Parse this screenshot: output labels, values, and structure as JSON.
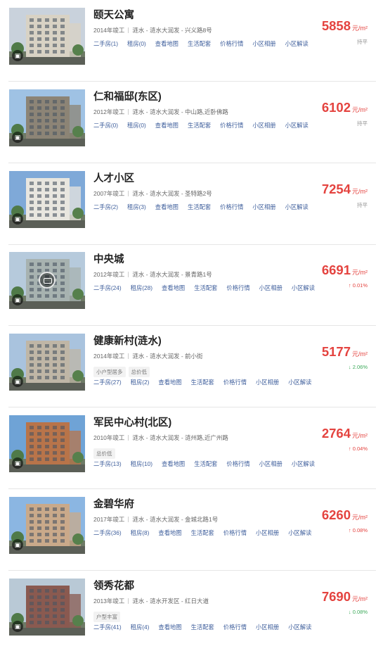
{
  "listings": [
    {
      "name": "颐天公寓",
      "year": "2014年竣工",
      "location": "涟水 - 涟水大润发 - 兴义路8号",
      "tags": [],
      "links": [
        "二手房(1)",
        "租房(0)",
        "查看地图",
        "生活配套",
        "价格行情",
        "小区相册",
        "小区解读"
      ],
      "price": "5858",
      "unit": "元/m²",
      "change": "持平",
      "trend": "flat",
      "sky": "#c9d2dc",
      "building": "#d8d2c4",
      "has_pano": false
    },
    {
      "name": "仁和福邸(东区)",
      "year": "2012年竣工",
      "location": "涟水 - 涟水大润发 - 中山路,近卧佛路",
      "tags": [],
      "links": [
        "二手房(0)",
        "租房(0)",
        "查看地图",
        "生活配套",
        "价格行情",
        "小区相册",
        "小区解读"
      ],
      "price": "6102",
      "unit": "元/m²",
      "change": "持平",
      "trend": "flat",
      "sky": "#9fc2e4",
      "building": "#8c8476",
      "has_pano": false
    },
    {
      "name": "人才小区",
      "year": "2007年竣工",
      "location": "涟水 - 涟水大润发 - 圣特路2号",
      "tags": [],
      "links": [
        "二手房(2)",
        "租房(3)",
        "查看地图",
        "生活配套",
        "价格行情",
        "小区相册",
        "小区解读"
      ],
      "price": "7254",
      "unit": "元/m²",
      "change": "持平",
      "trend": "flat",
      "sky": "#7fa9d8",
      "building": "#e8e6df",
      "has_pano": false
    },
    {
      "name": "中央城",
      "year": "2012年竣工",
      "location": "涟水 - 涟水大润发 - 景青路1号",
      "tags": [],
      "links": [
        "二手房(24)",
        "租房(28)",
        "查看地图",
        "生活配套",
        "价格行情",
        "小区相册",
        "小区解读"
      ],
      "price": "6691",
      "unit": "元/m²",
      "change": "↑ 0.01%",
      "trend": "up",
      "sky": "#b6cadc",
      "building": "#a7b2b0",
      "has_pano": true
    },
    {
      "name": "健康新村(涟水)",
      "year": "2014年竣工",
      "location": "涟水 - 涟水大润发 - 前小街",
      "tags": [
        "小户型居多",
        "总价低"
      ],
      "links": [
        "二手房(27)",
        "租房(2)",
        "查看地图",
        "生活配套",
        "价格行情",
        "小区相册",
        "小区解读"
      ],
      "price": "5177",
      "unit": "元/m²",
      "change": "↓ 2.06%",
      "trend": "down",
      "sky": "#a9c3de",
      "building": "#bfb6a6",
      "has_pano": false
    },
    {
      "name": "军民中心村(北区)",
      "year": "2010年竣工",
      "location": "涟水 - 涟水大润发 - 涟州路,近广州路",
      "tags": [
        "总价低"
      ],
      "links": [
        "二手房(13)",
        "租房(10)",
        "查看地图",
        "生活配套",
        "价格行情",
        "小区相册",
        "小区解读"
      ],
      "price": "2764",
      "unit": "元/m²",
      "change": "↑ 0.04%",
      "trend": "up",
      "sky": "#6fa3d6",
      "building": "#b8744a",
      "has_pano": false
    },
    {
      "name": "金碧华府",
      "year": "2017年竣工",
      "location": "涟水 - 涟水大润发 - 金城北路1号",
      "tags": [],
      "links": [
        "二手房(36)",
        "租房(8)",
        "查看地图",
        "生活配套",
        "价格行情",
        "小区相册",
        "小区解读"
      ],
      "price": "6260",
      "unit": "元/m²",
      "change": "↑ 0.08%",
      "trend": "up",
      "sky": "#8bb6e2",
      "building": "#c9a98a",
      "has_pano": false
    },
    {
      "name": "领秀花都",
      "year": "2013年竣工",
      "location": "涟水 - 涟水开发区 - 红日大道",
      "tags": [
        "户型丰富"
      ],
      "links": [
        "二手房(41)",
        "租房(4)",
        "查看地图",
        "生活配套",
        "价格行情",
        "小区相册",
        "小区解读"
      ],
      "price": "7690",
      "unit": "元/m²",
      "change": "↓ 0.08%",
      "trend": "down",
      "sky": "#b9c9d6",
      "building": "#8a5a50",
      "has_pano": false
    }
  ]
}
